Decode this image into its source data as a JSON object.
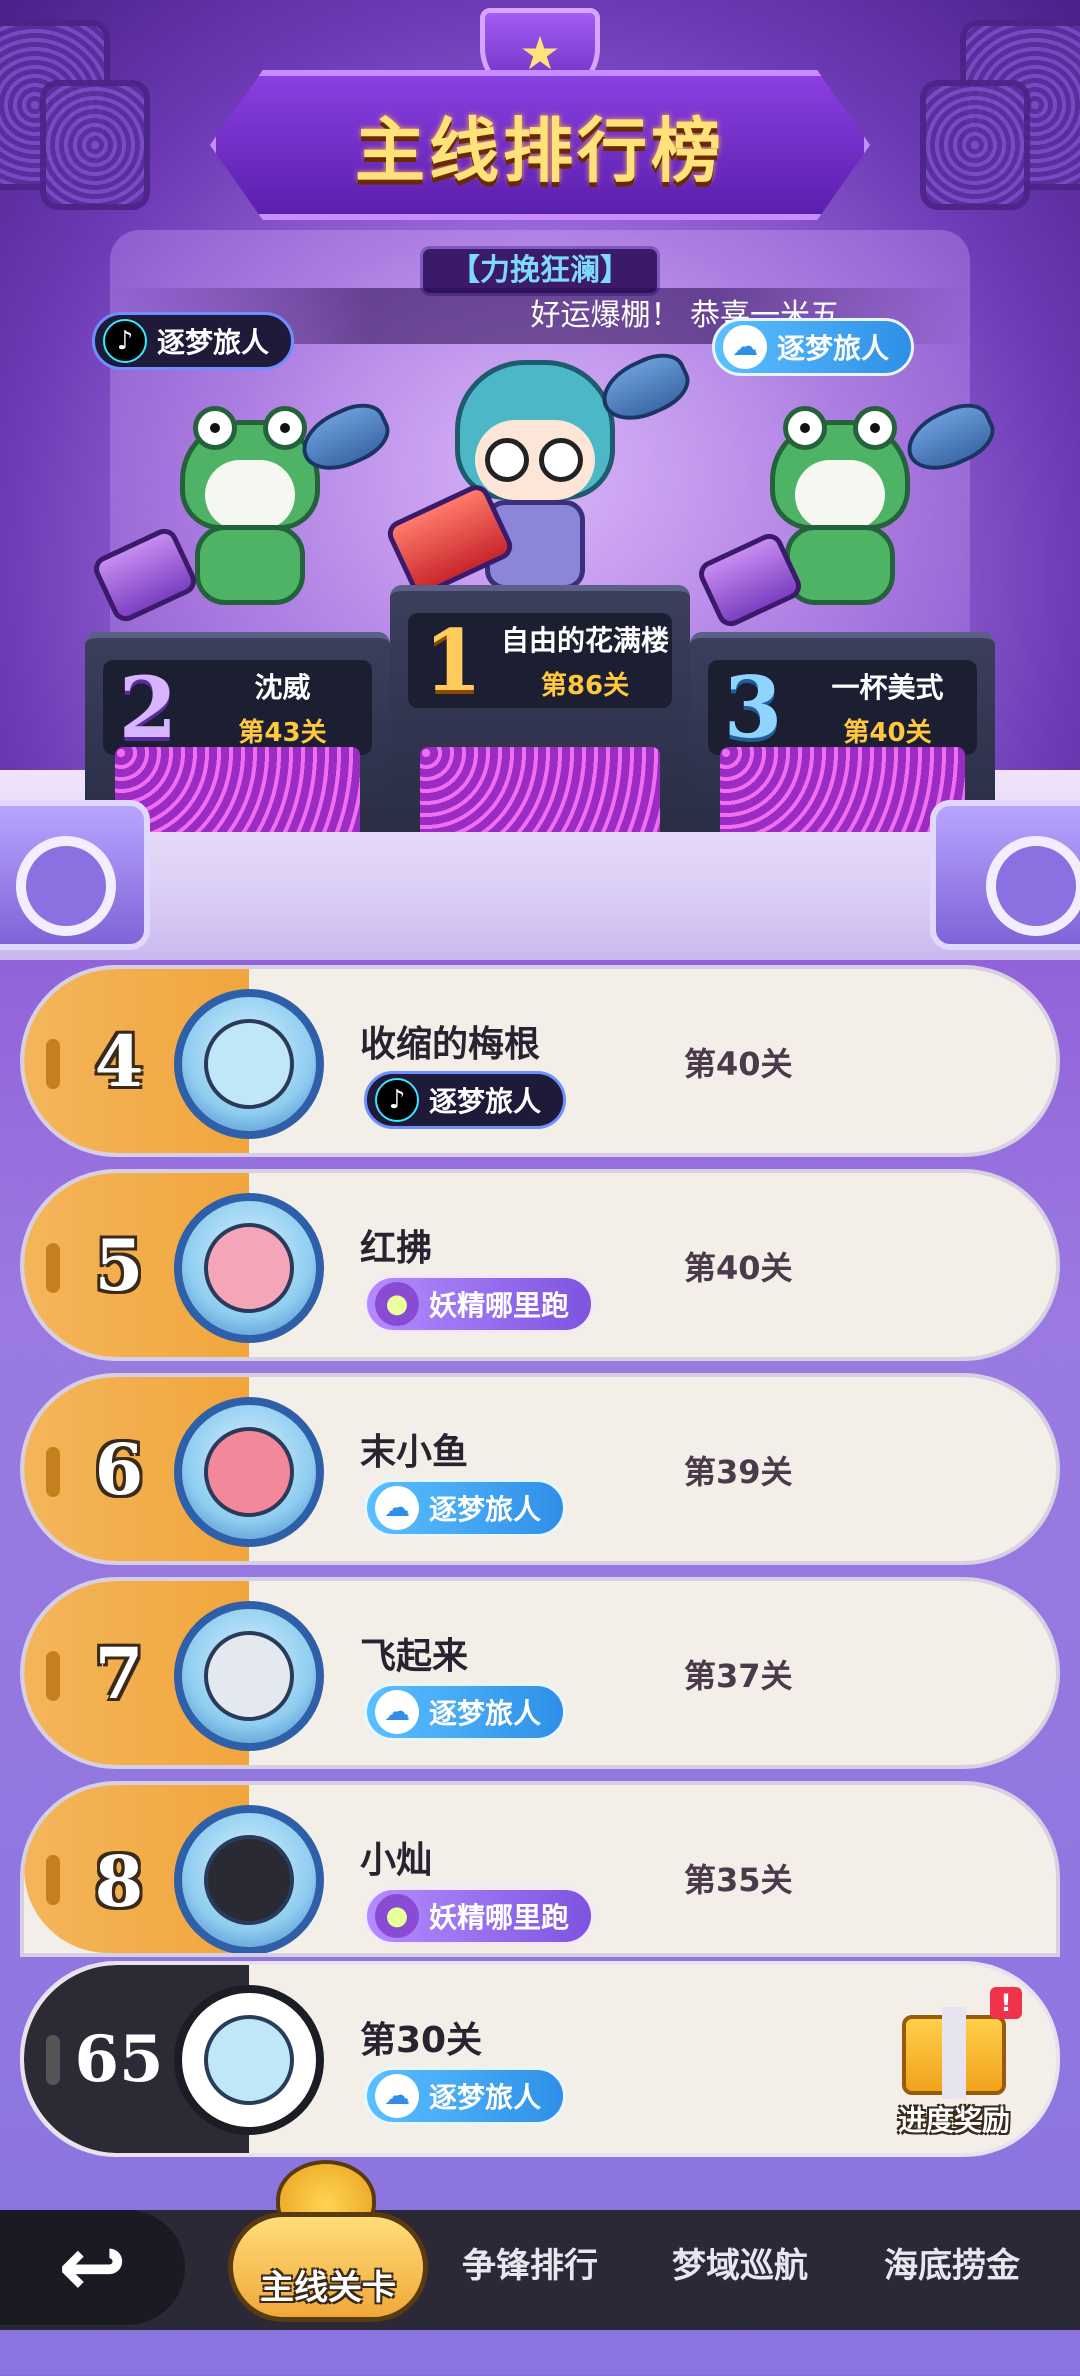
{
  "header": {
    "title": "主线排行榜",
    "subtitle": "【力挽狂澜】",
    "marquee": "好运爆棚！ 恭喜一米五",
    "top_left_badge": "逐梦旅人",
    "top_right_badge": "逐梦旅人"
  },
  "podium": [
    {
      "rank": "2",
      "name": "沈威",
      "level": "第43关"
    },
    {
      "rank": "1",
      "name": "自由的花满楼",
      "level": "第86关"
    },
    {
      "rank": "3",
      "name": "一杯美式",
      "level": "第40关"
    }
  ],
  "rows": [
    {
      "rank": "4",
      "name": "收缩的梅根",
      "level": "第40关",
      "tag": "逐梦旅人",
      "tag_icon": "tiktok-icon"
    },
    {
      "rank": "5",
      "name": "红拂",
      "level": "第40关",
      "tag": "妖精哪里跑",
      "tag_icon": "grape-icon"
    },
    {
      "rank": "6",
      "name": "末小鱼",
      "level": "第39关",
      "tag": "逐梦旅人",
      "tag_icon": "ghost-icon"
    },
    {
      "rank": "7",
      "name": "飞起来",
      "level": "第37关",
      "tag": "逐梦旅人",
      "tag_icon": "ghost-icon"
    },
    {
      "rank": "8",
      "name": "小灿",
      "level": "第35关",
      "tag": "妖精哪里跑",
      "tag_icon": "grape-icon"
    }
  ],
  "me": {
    "rank": "65",
    "level": "第30关",
    "tag": "逐梦旅人",
    "reward_label": "进度奖励",
    "reward_alert": "!"
  },
  "nav": {
    "back_icon": "↩",
    "active_tab": "主线关卡",
    "tabs": [
      "争锋排行",
      "梦域巡航",
      "海底捞金"
    ]
  },
  "colors": {
    "accent_gold": "#f4b55a",
    "title_yellow": "#ffe27a",
    "level_gold": "#ffc83d",
    "background_purple": "#8a74e0"
  }
}
